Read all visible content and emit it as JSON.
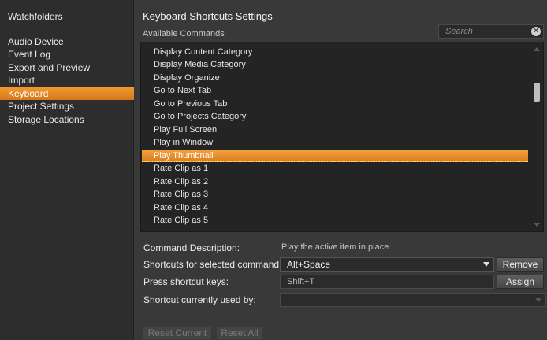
{
  "sidebar": {
    "items": [
      {
        "label": "Watchfolders",
        "selected": false
      },
      {
        "label": "Audio Device",
        "selected": false
      },
      {
        "label": "Event Log",
        "selected": false
      },
      {
        "label": "Export and Preview",
        "selected": false
      },
      {
        "label": "Import",
        "selected": false
      },
      {
        "label": "Keyboard",
        "selected": true
      },
      {
        "label": "Project Settings",
        "selected": false
      },
      {
        "label": "Storage Locations",
        "selected": false
      }
    ]
  },
  "main": {
    "title": "Keyboard Shortcuts Settings",
    "available_label": "Available Commands",
    "search": {
      "placeholder": "Search",
      "value": ""
    },
    "commands": [
      "Display Content Category",
      "Display Media Category",
      "Display Organize",
      "Go to Next Tab",
      "Go to Previous Tab",
      "Go to Projects Category",
      "Play Full Screen",
      "Play in Window",
      "Play Thumbnail",
      "Rate Clip as 1",
      "Rate Clip as 2",
      "Rate Clip as 3",
      "Rate Clip as 4",
      "Rate Clip as 5"
    ],
    "selected_command": "Play Thumbnail",
    "command_description_label": "Command Description:",
    "command_description": "Play the active item in place",
    "shortcuts_label": "Shortcuts for selected command:",
    "shortcut_value": "Alt+Space",
    "remove_label": "Remove",
    "press_keys_label": "Press shortcut keys:",
    "press_keys_value": "Shift+T",
    "assign_label": "Assign",
    "used_by_label": "Shortcut currently used by:",
    "used_by_value": "",
    "reset_current_label": "Reset Current",
    "reset_all_label": "Reset All"
  },
  "colors": {
    "accent": "#e88a26",
    "panel": "#393939",
    "list_bg": "#242424"
  }
}
